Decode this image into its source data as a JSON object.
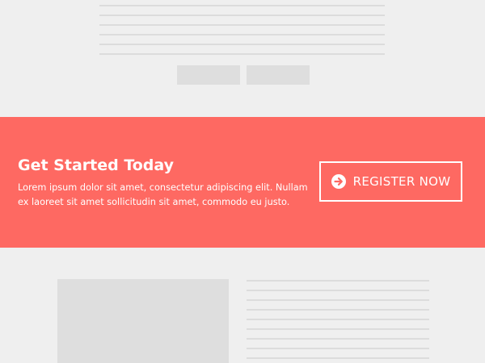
{
  "cta": {
    "title": "Get Started Today",
    "text": "Lorem ipsum dolor sit amet, consectetur adipiscing elit. Nullam ex laoreet sit amet sollicitudin sit amet, commodo eu justo.",
    "button_label": "REGISTER NOW",
    "button_icon": "arrow-circle-right-icon"
  },
  "colors": {
    "page_background": "#efefef",
    "banner_background": "#fe6962",
    "text": "#ffffff",
    "placeholder": "#dcdcdc"
  }
}
